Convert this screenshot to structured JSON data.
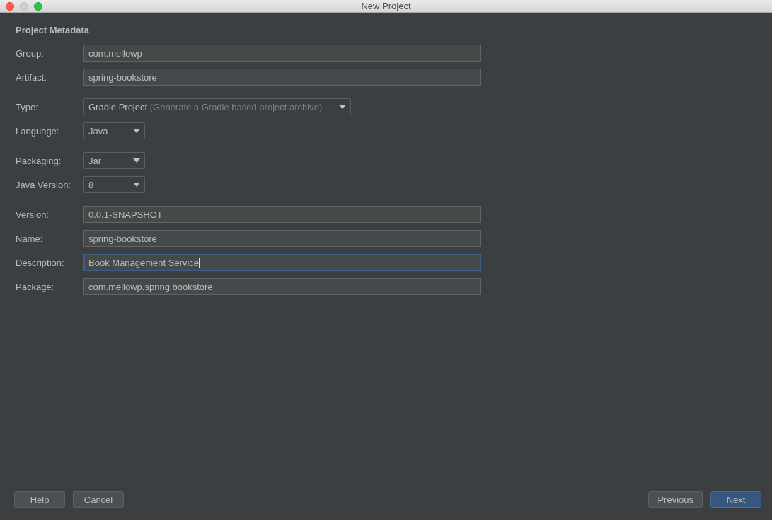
{
  "window": {
    "title": "New Project"
  },
  "heading": "Project Metadata",
  "sections": [
    [
      {
        "label": "Group:",
        "kind": "text",
        "value": "com.mellowp",
        "focused": false
      },
      {
        "label": "Artifact:",
        "kind": "text",
        "value": "spring-bookstore",
        "focused": false
      }
    ],
    [
      {
        "label": "Type:",
        "kind": "dropdown",
        "value": "Gradle Project",
        "hint": "(Generate a Gradle based project archive)"
      },
      {
        "label": "Language:",
        "kind": "dropdown",
        "value": "Java"
      }
    ],
    [
      {
        "label": "Packaging:",
        "kind": "dropdown",
        "value": "Jar"
      },
      {
        "label": "Java Version:",
        "kind": "dropdown",
        "value": "8"
      }
    ],
    [
      {
        "label": "Version:",
        "kind": "text",
        "value": "0.0.1-SNAPSHOT",
        "focused": false
      },
      {
        "label": "Name:",
        "kind": "text",
        "value": "spring-bookstore",
        "focused": false
      },
      {
        "label": "Description:",
        "kind": "text",
        "value": "Book Management Service",
        "focused": true
      },
      {
        "label": "Package:",
        "kind": "text",
        "value": "com.mellowp.spring.bookstore",
        "focused": false
      }
    ]
  ],
  "buttons_left": [
    {
      "label": "Help",
      "kind": "default"
    },
    {
      "label": "Cancel",
      "kind": "default"
    }
  ],
  "buttons_right": [
    {
      "label": "Previous",
      "kind": "default"
    },
    {
      "label": "Next",
      "kind": "primary"
    }
  ]
}
